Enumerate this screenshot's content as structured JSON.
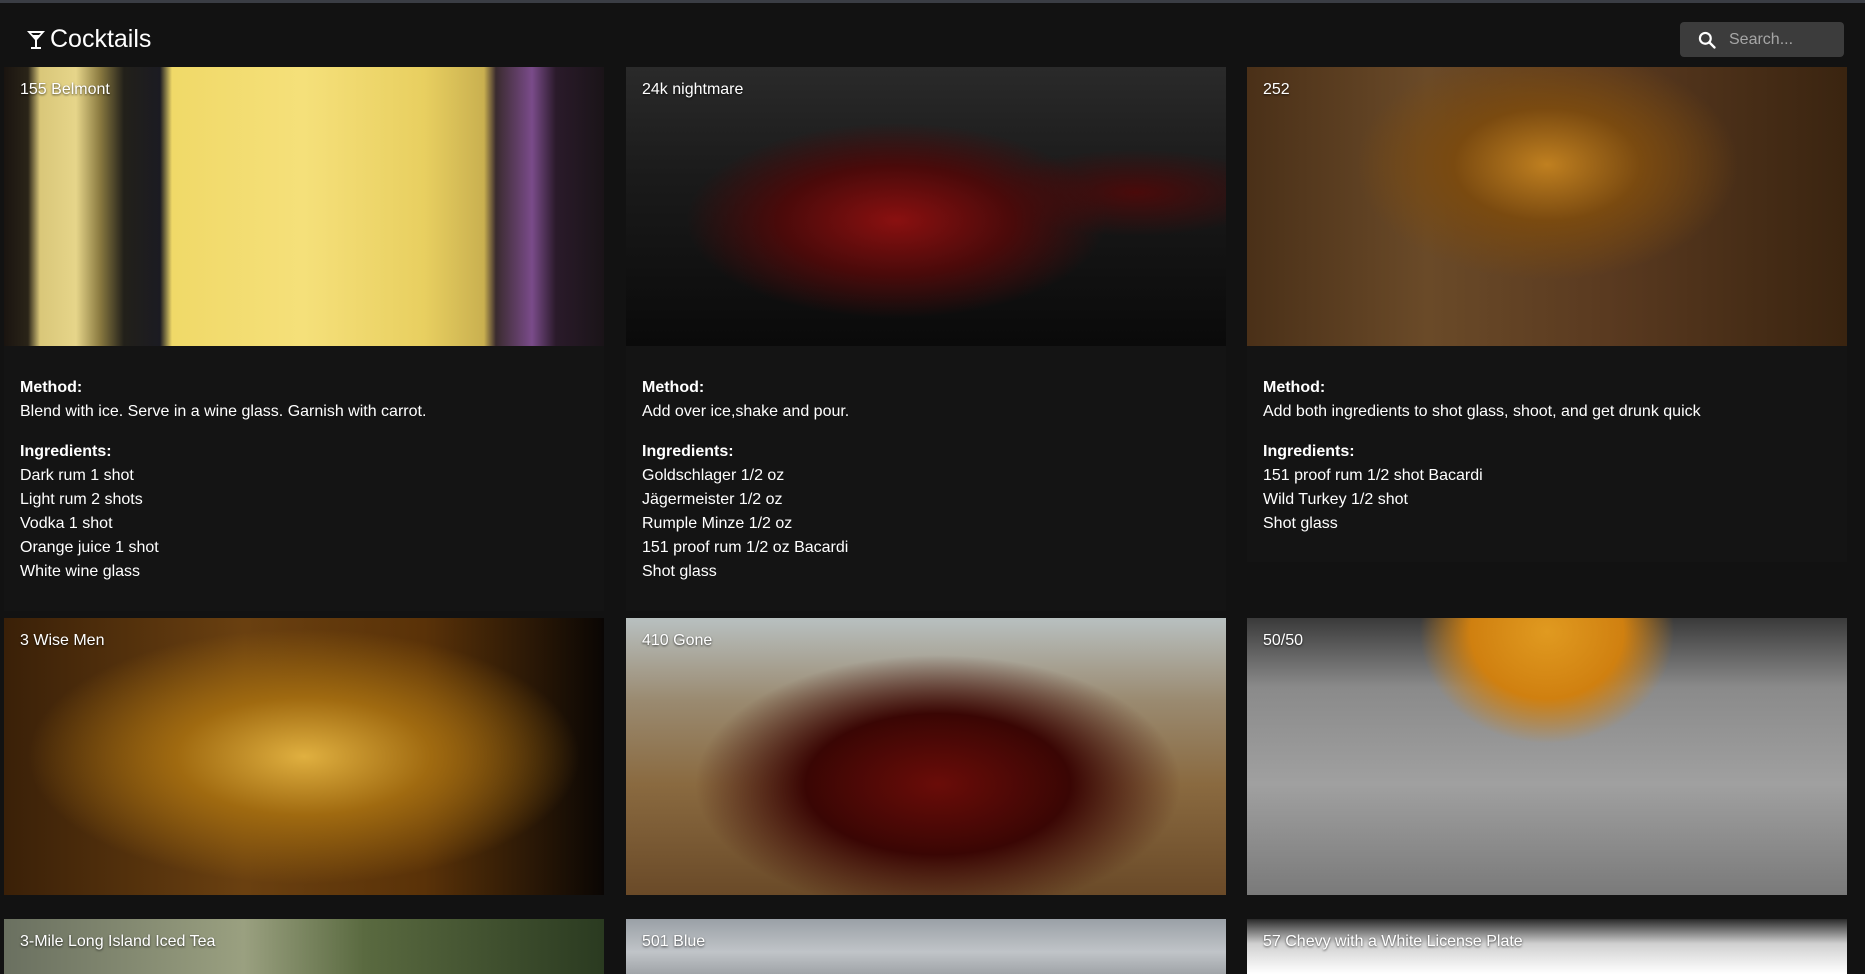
{
  "app": {
    "title": "Cocktails",
    "brand_icon": "cocktail-glass-icon"
  },
  "search": {
    "placeholder": "Search...",
    "icon": "search-icon"
  },
  "labels": {
    "method": "Method:",
    "ingredients": "Ingredients:"
  },
  "cards": [
    {
      "name": "155 Belmont",
      "method": "Blend with ice. Serve in a wine glass. Garnish with carrot.",
      "ingredients": [
        "Dark rum 1 shot",
        "Light rum 2 shots",
        "Vodka 1 shot",
        "Orange juice 1 shot",
        "White wine glass"
      ]
    },
    {
      "name": "24k nightmare",
      "method": "Add over ice,shake and pour.",
      "ingredients": [
        "Goldschlager 1/2 oz",
        "Jägermeister 1/2 oz",
        "Rumple Minze 1/2 oz",
        "151 proof rum 1/2 oz Bacardi",
        "Shot glass"
      ]
    },
    {
      "name": "252",
      "method": "Add both ingredients to shot glass, shoot, and get drunk quick",
      "ingredients": [
        "151 proof rum 1/2 shot Bacardi",
        "Wild Turkey 1/2 shot",
        "Shot glass"
      ]
    },
    {
      "name": "3 Wise Men"
    },
    {
      "name": "410 Gone"
    },
    {
      "name": "50/50"
    },
    {
      "name": "3-Mile Long Island Iced Tea"
    },
    {
      "name": "501 Blue"
    },
    {
      "name": "57 Chevy with a White License Plate"
    }
  ]
}
